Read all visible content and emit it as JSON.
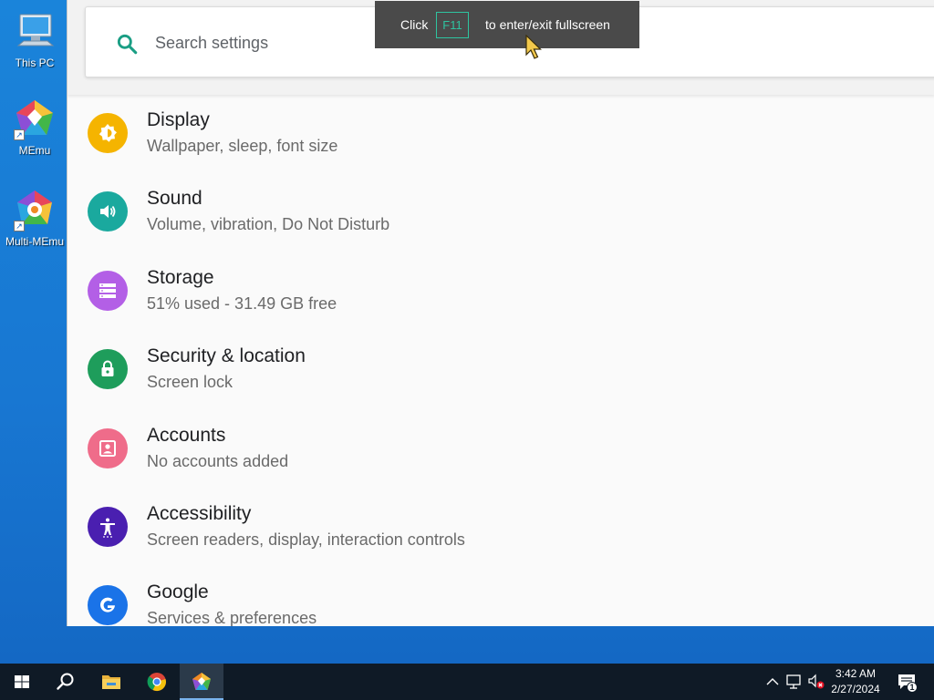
{
  "desktop": {
    "icons": [
      {
        "label": "This PC",
        "icon": "computer-icon"
      },
      {
        "label": "MEmu",
        "icon": "memu-icon"
      },
      {
        "label": "Multi-MEmu",
        "icon": "multi-memu-icon"
      }
    ]
  },
  "fullscreen_hint": {
    "prefix": "Click",
    "key": "F11",
    "suffix": "to enter/exit fullscreen"
  },
  "search": {
    "placeholder": "Search settings",
    "value": ""
  },
  "settings": [
    {
      "title": "Display",
      "subtitle": "Wallpaper, sleep, font size",
      "color": "#f5b400",
      "icon": "brightness-icon"
    },
    {
      "title": "Sound",
      "subtitle": "Volume, vibration, Do Not Disturb",
      "color": "#1aa99e",
      "icon": "volume-icon"
    },
    {
      "title": "Storage",
      "subtitle": "51% used - 31.49 GB free",
      "color": "#b35fe6",
      "icon": "storage-icon"
    },
    {
      "title": "Security & location",
      "subtitle": "Screen lock",
      "color": "#1e9d5b",
      "icon": "lock-icon"
    },
    {
      "title": "Accounts",
      "subtitle": "No accounts added",
      "color": "#ef6c8a",
      "icon": "account-icon"
    },
    {
      "title": "Accessibility",
      "subtitle": "Screen readers, display, interaction controls",
      "color": "#4a1fb0",
      "icon": "accessibility-icon"
    },
    {
      "title": "Google",
      "subtitle": "Services & preferences",
      "color": "#1a73e8",
      "icon": "google-icon"
    }
  ],
  "taskbar": {
    "apps": [
      "start-icon",
      "search-icon",
      "file-explorer-icon",
      "chrome-icon",
      "memu-icon"
    ],
    "active_app": "memu-icon",
    "time": "3:42 AM",
    "date": "2/27/2024",
    "notification_count": "1"
  },
  "colors": {
    "accent_teal": "#1a9e84",
    "desktop_blue": "#1a7fd8",
    "taskbar": "#0f1a26"
  }
}
